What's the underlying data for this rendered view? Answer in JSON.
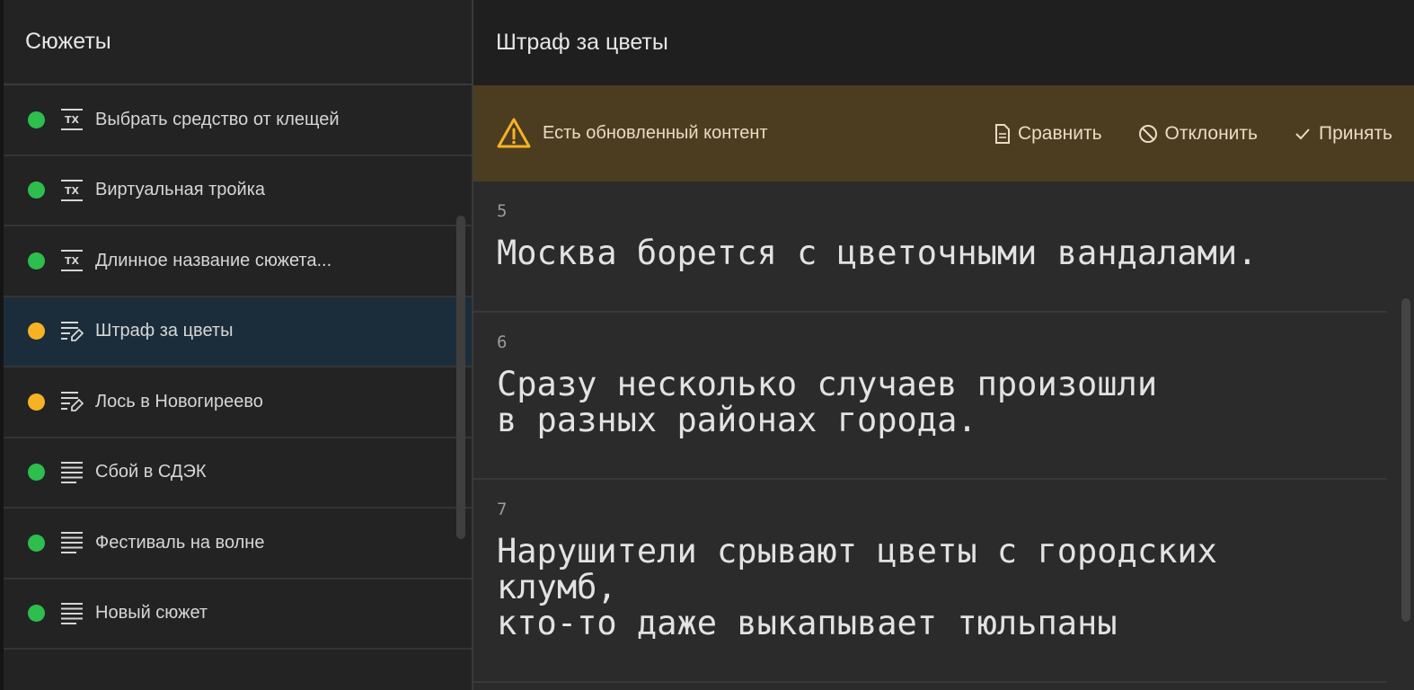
{
  "sidebar": {
    "title": "Сюжеты",
    "items": [
      {
        "label": "Выбрать средство от клещей",
        "status": "green",
        "icon": "tx-icon"
      },
      {
        "label": "Виртуальная тройка",
        "status": "green",
        "icon": "tx-icon"
      },
      {
        "label": "Длинное название сюжета...",
        "status": "green",
        "icon": "tx-icon"
      },
      {
        "label": "Штраф за цветы",
        "status": "yellow",
        "icon": "edit-doc-icon",
        "selected": true
      },
      {
        "label": "Лось в Новогиреево",
        "status": "yellow",
        "icon": "edit-doc-icon"
      },
      {
        "label": "Сбой в СДЭК",
        "status": "green",
        "icon": "text-lines-icon"
      },
      {
        "label": "Фестиваль на волне",
        "status": "green",
        "icon": "text-lines-icon"
      },
      {
        "label": "Новый сюжет",
        "status": "green",
        "icon": "text-lines-icon"
      }
    ]
  },
  "main": {
    "title": "Штраф за цветы",
    "banner": {
      "text": "Есть обновленный контент",
      "compare_label": "Сравнить",
      "reject_label": "Отклонить",
      "accept_label": "Принять"
    },
    "segments": [
      {
        "number": "5",
        "text": "Москва борется с цветочными вандалами."
      },
      {
        "number": "6",
        "text": "Сразу несколько случаев произошли\nв разных районах города."
      },
      {
        "number": "7",
        "text": "Нарушители срывают цветы с городских\nклумб,\nкто-то даже выкапывает тюльпаны"
      }
    ]
  },
  "colors": {
    "status_green": "#2dbe4e",
    "status_yellow": "#f5b324",
    "banner_bg": "#4d3d20",
    "selected_bg": "#1b2d3b"
  }
}
